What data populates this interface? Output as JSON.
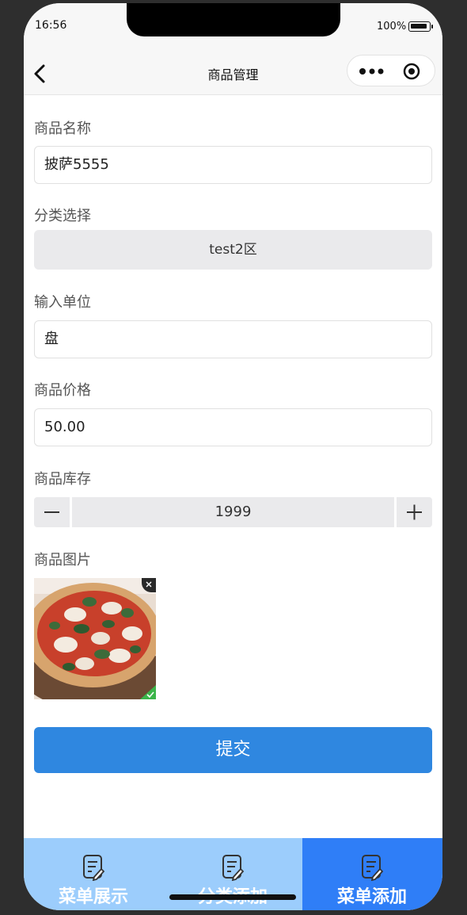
{
  "status_bar": {
    "time": "16:56",
    "battery": "100%"
  },
  "nav": {
    "title": "商品管理"
  },
  "form": {
    "name": {
      "label": "商品名称",
      "value": "披萨5555"
    },
    "category": {
      "label": "分类选择",
      "value": "test2区"
    },
    "unit": {
      "label": "输入单位",
      "value": "盘"
    },
    "price": {
      "label": "商品价格",
      "value": "50.00"
    },
    "stock": {
      "label": "商品库存",
      "value": "1999"
    },
    "image": {
      "label": "商品图片"
    },
    "submit_label": "提交"
  },
  "tabbar": {
    "items": [
      {
        "label": "菜单展示"
      },
      {
        "label": "分类添加"
      },
      {
        "label": "菜单添加"
      }
    ],
    "active_index": 2
  },
  "colors": {
    "accent": "#2f87e0",
    "tab_inactive": "#9ccdfc",
    "tab_active": "#2f7ef7"
  },
  "icons": [
    "back-arrow-icon",
    "more-dots-icon",
    "target-circle-icon",
    "minus-icon",
    "plus-icon",
    "close-icon",
    "check-icon",
    "edit-document-icon"
  ]
}
